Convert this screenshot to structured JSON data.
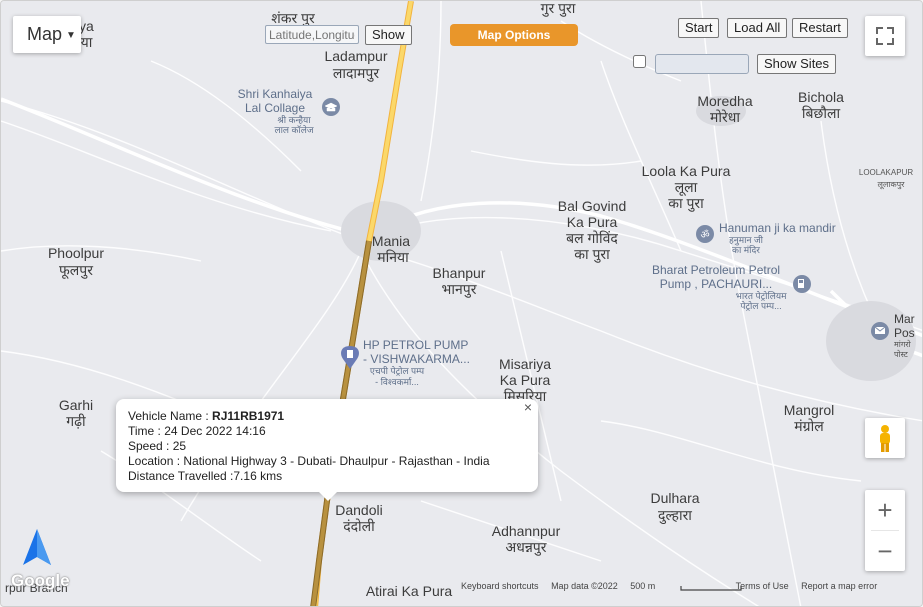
{
  "controls": {
    "map_type": "Map",
    "latlng_placeholder": "Latitude,Longitude",
    "show_label": "Show",
    "map_options_label": "Map Options",
    "start_label": "Start",
    "load_all_label": "Load All",
    "restart_label": "Restart",
    "show_sites_label": "Show Sites"
  },
  "places": {
    "diya_en": "diya",
    "diya_hi": "दिया",
    "shankarpur_hi": "शंकर पुर",
    "ladampur_en": "Ladampur",
    "ladampur_hi": "लादामपुर",
    "top_hi": "गुर पुरा",
    "moredha_en": "Moredha",
    "moredha_hi": "मोरेधा",
    "bichola_en": "Bichola",
    "bichola_hi": "बिछौला",
    "loola_en": "Loola Ka Pura",
    "loola_hi1": "लूला",
    "loola_hi2": "का पुरा",
    "loolakapur_en": "LOOLAKAPUR",
    "loolakapur_hi": "लूलाकपुर",
    "balgovind_en1": "Bal Govind",
    "balgovind_en2": "Ka Pura",
    "balgovind_hi1": "बल गोविंद",
    "balgovind_hi2": "का पुरा",
    "mania_en": "Mania",
    "mania_hi": "मनिया",
    "phoolpur_en": "Phoolpur",
    "phoolpur_hi": "फूलपुर",
    "bhanpur_en": "Bhanpur",
    "bhanpur_hi": "भानपुर",
    "misariya_en1": "Misariya",
    "misariya_en2": "Ka Pura",
    "misariya_hi": "मिसरिया",
    "garhi_en": "Garhi",
    "garhi_hi": "गढ़ी",
    "mangrol_en": "Mangrol",
    "mangrol_hi": "मंग्रोल",
    "dulhara_en": "Dulhara",
    "dulhara_hi": "दुल्हारा",
    "dandoli_en": "Dandoli",
    "dandoli_hi": "दंदोली",
    "adhannpur_en": "Adhannpur",
    "adhannpur_hi": "अधन्नपुर",
    "atirai_en": "Atirai Ka Pura",
    "mar_en1": "Mar",
    "mar_en2": "Pos",
    "mar_hi1": "मांगरो",
    "mar_hi2": "पोस्ट",
    "bottomleft": "rpur Branch"
  },
  "pois": {
    "college_en1": "Shri Kanhaiya",
    "college_en2": "Lal Collage",
    "college_hi1": "श्री कन्हैया",
    "college_hi2": "लाल कॉलेज",
    "temple_en": "Hanuman ji ka mandir",
    "temple_hi1": "हनुमान जी",
    "temple_hi2": "का मंदिर",
    "bharat_en1": "Bharat Petroleum Petrol",
    "bharat_en2": "Pump , PACHAURI...",
    "bharat_hi1": "भारत पेट्रोलियम",
    "bharat_hi2": "पेट्रोल पम्प...",
    "hp_en1": "HP PETROL PUMP",
    "hp_en2": "- VISHWAKARMA...",
    "hp_hi1": "एचपी पेट्रोल पम्प",
    "hp_hi2": "- विश्वकर्मा..."
  },
  "infowindow": {
    "vehicle_label": "Vehicle Name : ",
    "vehicle_value": "RJ11RB1971",
    "time": "Time : 24 Dec 2022 14:16",
    "speed": "Speed : 25",
    "location": "Location : National Highway 3 - Dubati- Dhaulpur - Rajasthan - India",
    "distance": "Distance Travelled :7.16 kms",
    "close_symbol": "×"
  },
  "footer": {
    "shortcuts": "Keyboard shortcuts",
    "mapdata": "Map data ©2022",
    "scale": "500 m",
    "terms": "Terms of Use",
    "report": "Report a map error"
  },
  "logo": "Google",
  "colors": {
    "highway": "#f5c542",
    "route": "#b38a3c",
    "map_options_btn": "#e9962a",
    "map_bg": "#e9eaee"
  }
}
